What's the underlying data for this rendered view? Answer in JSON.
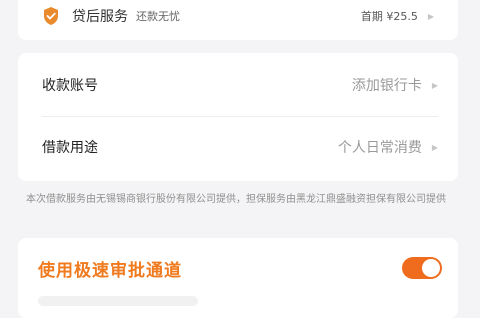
{
  "service": {
    "title": "贷后服务",
    "subtitle": "还款无忧",
    "first_period": "首期 ¥25.5",
    "icon": "shield-check-icon",
    "icon_color": "#e98a2c"
  },
  "account": {
    "label": "收款账号",
    "value": "添加银行卡"
  },
  "purpose": {
    "label": "借款用途",
    "value": "个人日常消费"
  },
  "disclaimer": "本次借款服务由无锡锡商银行股份有限公司提供，担保服务由黑龙江鼎盛融资担保有限公司提供",
  "fast_channel": {
    "title": "使用极速审批通道",
    "enabled": true,
    "accent_color": "#f07a1e"
  }
}
